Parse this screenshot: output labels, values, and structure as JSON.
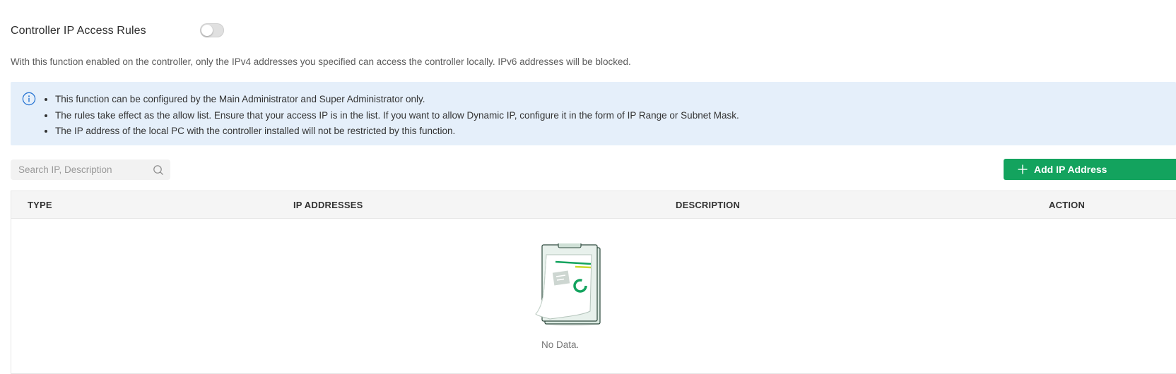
{
  "header": {
    "title": "Controller IP Access Rules",
    "toggle_state": "off"
  },
  "description": "With this function enabled on the controller, only the IPv4 addresses you specified can access the controller locally. IPv6 addresses will be blocked.",
  "notice": {
    "icon": "info-icon",
    "items": [
      "This function can be configured by the Main Administrator and Super Administrator only.",
      "The rules take effect as the allow list. Ensure that your access IP is in the list. If you want to allow Dynamic IP, configure it in the form of IP Range or Subnet Mask.",
      "The IP address of the local PC with the controller installed will not be restricted by this function."
    ]
  },
  "search": {
    "placeholder": "Search IP, Description",
    "value": "",
    "icon": "search-icon"
  },
  "toolbar": {
    "add_label": "Add IP Address",
    "add_icon": "plus-icon"
  },
  "table": {
    "columns": [
      "TYPE",
      "IP ADDRESSES",
      "DESCRIPTION",
      "ACTION"
    ],
    "rows": [],
    "empty_text": "No Data."
  },
  "colors": {
    "accent": "#13a35e",
    "notice_bg": "#e5effa",
    "info_icon": "#1f6fd1"
  }
}
